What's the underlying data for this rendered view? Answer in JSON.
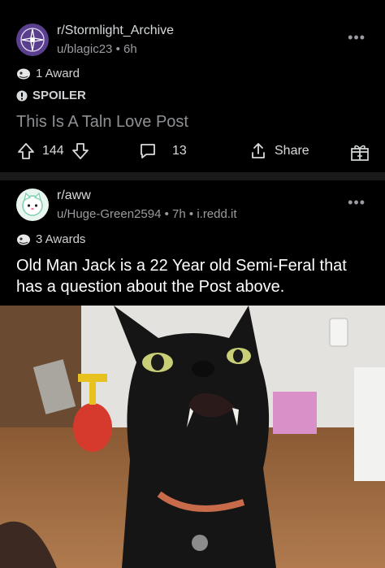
{
  "posts": [
    {
      "subreddit": "r/Stormlight_Archive",
      "user": "u/blagic23",
      "age": "6h",
      "awards": "1 Award",
      "tag": "SPOILER",
      "title": "This Is A Taln Love Post",
      "upvotes": "144",
      "comments": "13",
      "share": "Share"
    },
    {
      "subreddit": "r/aww",
      "user": "u/Huge-Green2594",
      "age": "7h",
      "domain": "i.redd.it",
      "awards": "3 Awards",
      "title": "Old Man Jack is a 22 Year old Semi-Feral that has a question about the Post above."
    }
  ],
  "icons": {
    "more": "more-dots-icon",
    "upvote": "upvote-arrow-icon",
    "downvote": "downvote-arrow-icon",
    "comment": "comment-bubble-icon",
    "share": "share-icon",
    "award": "gift-award-icon"
  },
  "colors": {
    "background": "#000000",
    "separator": "#1a1a1b",
    "text": "#d7dadc",
    "meta": "#9a9ca0",
    "subreddit_avatar_1": "#5b3f8f",
    "subreddit_avatar_2": "#e8f6ef"
  }
}
